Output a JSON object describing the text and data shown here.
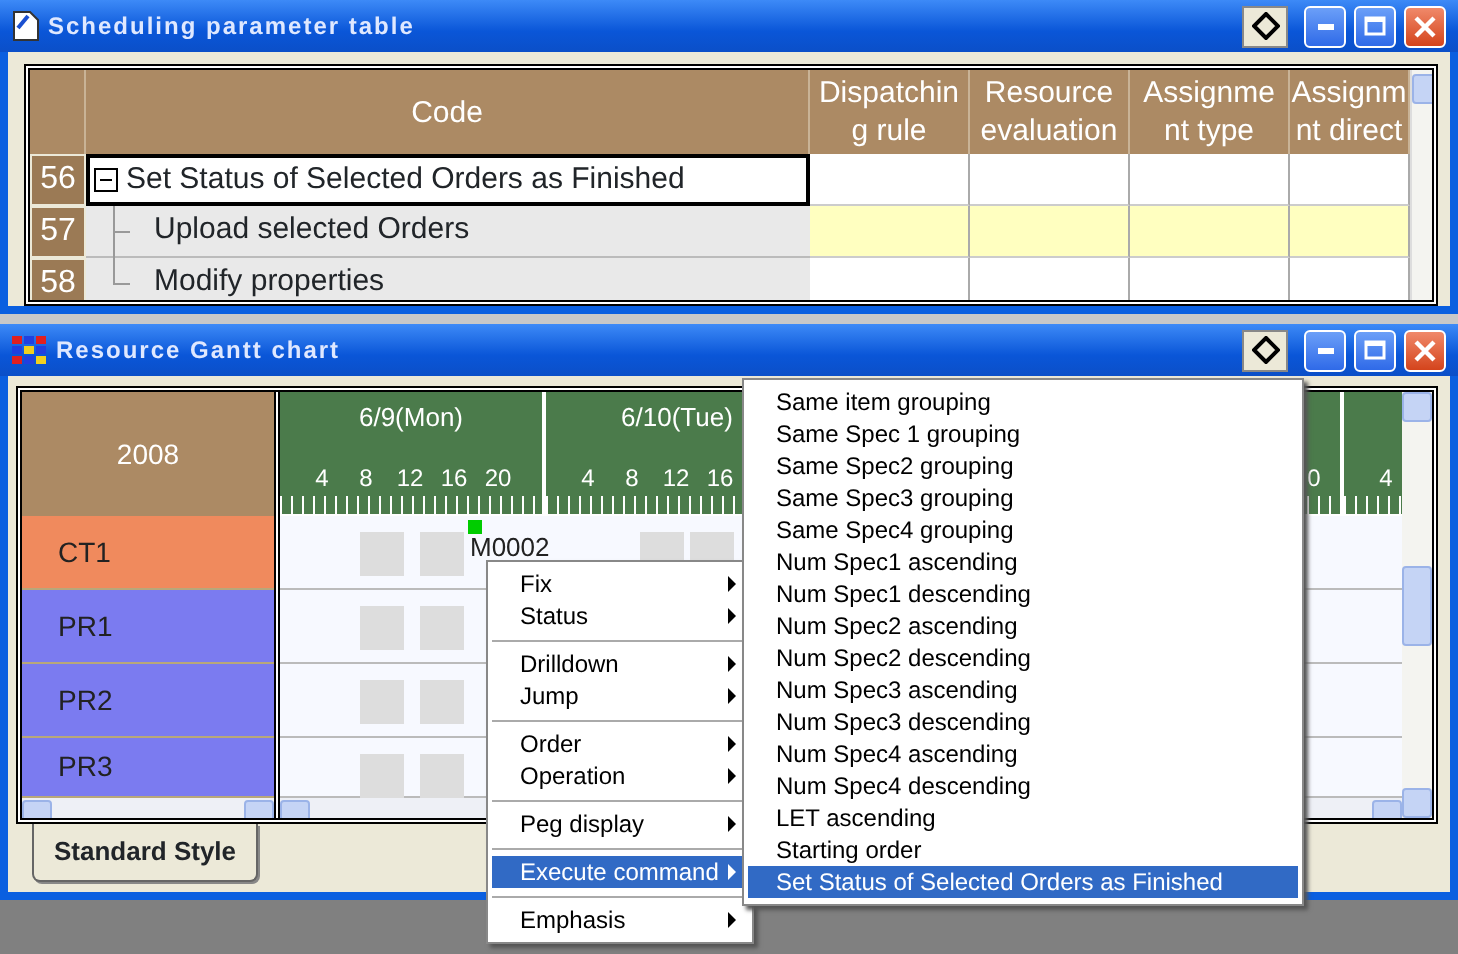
{
  "top_window": {
    "title": "Scheduling parameter table",
    "columns": [
      {
        "lines": [
          "Code"
        ]
      },
      {
        "lines": [
          "Dispatchin",
          "g rule"
        ]
      },
      {
        "lines": [
          "Resource",
          "evaluation"
        ]
      },
      {
        "lines": [
          "Assignme",
          "nt type"
        ]
      },
      {
        "lines": [
          "Assignm",
          "nt direct"
        ]
      }
    ],
    "rows": [
      {
        "number": "56",
        "code": "Set Status of Selected Orders as Finished",
        "kind": "parent",
        "expanded": true,
        "focused": true,
        "highlighted": false
      },
      {
        "number": "57",
        "code": "Upload selected Orders",
        "kind": "child",
        "focused": false,
        "highlighted": true
      },
      {
        "number": "58",
        "code": "Modify properties",
        "kind": "last-child",
        "focused": false,
        "highlighted": false
      }
    ]
  },
  "gantt_window": {
    "title": "Resource Gantt chart",
    "year": "2008",
    "days": [
      {
        "label": "6/9(Mon)",
        "hours": [
          "4",
          "8",
          "12",
          "16",
          "20"
        ]
      },
      {
        "label": "6/10(Tue)",
        "hours": [
          "4",
          "8",
          "12",
          "16"
        ]
      },
      {
        "hours": [
          "0"
        ],
        "cut_left": true
      },
      {
        "hours": [
          "4"
        ]
      }
    ],
    "resources": [
      {
        "name": "CT1",
        "color": "#f08a5d",
        "task": "M0002"
      },
      {
        "name": "PR1",
        "color": "#7b7bf0"
      },
      {
        "name": "PR2",
        "color": "#7b7bf0"
      },
      {
        "name": "PR3",
        "color": "#7b7bf0"
      }
    ],
    "style_tab": "Standard Style"
  },
  "context_menu": [
    {
      "kind": "item",
      "label": "Fix",
      "submenu": true,
      "selected": false
    },
    {
      "kind": "item",
      "label": "Status",
      "submenu": true,
      "selected": false
    },
    {
      "kind": "separator"
    },
    {
      "kind": "item",
      "label": "Drilldown",
      "submenu": true,
      "selected": false
    },
    {
      "kind": "item",
      "label": "Jump",
      "submenu": true,
      "selected": false
    },
    {
      "kind": "separator"
    },
    {
      "kind": "item",
      "label": "Order",
      "submenu": true,
      "selected": false
    },
    {
      "kind": "item",
      "label": "Operation",
      "submenu": true,
      "selected": false
    },
    {
      "kind": "separator"
    },
    {
      "kind": "item",
      "label": "Peg display",
      "submenu": true,
      "selected": false
    },
    {
      "kind": "separator"
    },
    {
      "kind": "item",
      "label": "Execute command",
      "submenu": true,
      "selected": true
    },
    {
      "kind": "separator"
    },
    {
      "kind": "item",
      "label": "Emphasis",
      "submenu": true,
      "selected": false
    }
  ],
  "submenu": [
    {
      "label": "Same item grouping",
      "selected": false
    },
    {
      "label": "Same Spec 1 grouping",
      "selected": false
    },
    {
      "label": "Same Spec2 grouping",
      "selected": false
    },
    {
      "label": "Same Spec3 grouping",
      "selected": false
    },
    {
      "label": "Same Spec4 grouping",
      "selected": false
    },
    {
      "label": "Num Spec1 ascending",
      "selected": false
    },
    {
      "label": "Num Spec1 descending",
      "selected": false
    },
    {
      "label": "Num Spec2 ascending",
      "selected": false
    },
    {
      "label": "Num Spec2 descending",
      "selected": false
    },
    {
      "label": "Num Spec3 ascending",
      "selected": false
    },
    {
      "label": "Num Spec3 descending",
      "selected": false
    },
    {
      "label": "Num Spec4 ascending",
      "selected": false
    },
    {
      "label": "Num Spec4 descending",
      "selected": false
    },
    {
      "label": "LET ascending",
      "selected": false
    },
    {
      "label": "Starting order",
      "selected": false
    },
    {
      "label": "Set Status of Selected Orders as Finished",
      "selected": true
    }
  ]
}
